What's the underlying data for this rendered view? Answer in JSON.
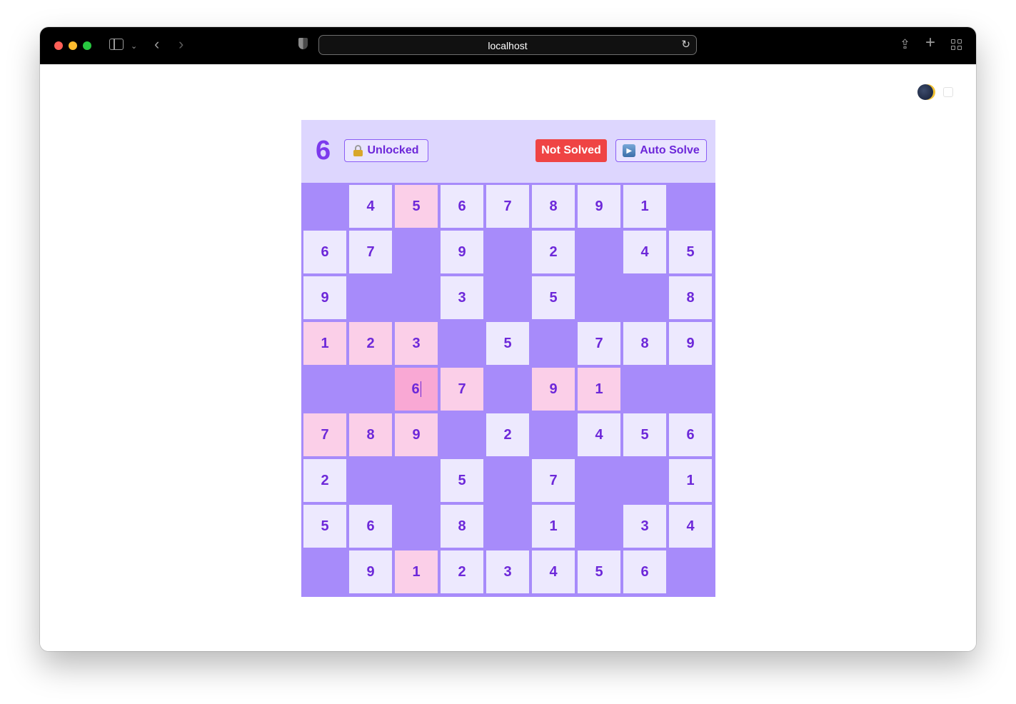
{
  "browser": {
    "url": "localhost"
  },
  "game": {
    "selected_digit": "6",
    "lock_label": "Unlocked",
    "status_label": "Not Solved",
    "auto_solve_label": "Auto Solve",
    "colors": {
      "accent": "#7c3aed",
      "panel": "#ddd6fe",
      "cell": "#ede9fe",
      "blocked": "#a78bfa",
      "highlight": "#fbcfe8",
      "active": "#f9a8d4",
      "status": "#ef4444"
    },
    "active_cell": {
      "row": 4,
      "col": 2
    },
    "board": [
      [
        {
          "v": "",
          "t": "blocked"
        },
        {
          "v": "4",
          "t": "normal"
        },
        {
          "v": "5",
          "t": "pink"
        },
        {
          "v": "6",
          "t": "normal"
        },
        {
          "v": "7",
          "t": "normal"
        },
        {
          "v": "8",
          "t": "normal"
        },
        {
          "v": "9",
          "t": "normal"
        },
        {
          "v": "1",
          "t": "normal"
        },
        {
          "v": "",
          "t": "blocked"
        }
      ],
      [
        {
          "v": "6",
          "t": "normal"
        },
        {
          "v": "7",
          "t": "normal"
        },
        {
          "v": "",
          "t": "blocked"
        },
        {
          "v": "9",
          "t": "normal"
        },
        {
          "v": "",
          "t": "blocked"
        },
        {
          "v": "2",
          "t": "normal"
        },
        {
          "v": "",
          "t": "blocked"
        },
        {
          "v": "4",
          "t": "normal"
        },
        {
          "v": "5",
          "t": "normal"
        }
      ],
      [
        {
          "v": "9",
          "t": "normal"
        },
        {
          "v": "",
          "t": "blocked"
        },
        {
          "v": "",
          "t": "blocked"
        },
        {
          "v": "3",
          "t": "normal"
        },
        {
          "v": "",
          "t": "blocked"
        },
        {
          "v": "5",
          "t": "normal"
        },
        {
          "v": "",
          "t": "blocked"
        },
        {
          "v": "",
          "t": "blocked"
        },
        {
          "v": "8",
          "t": "normal"
        }
      ],
      [
        {
          "v": "1",
          "t": "pink"
        },
        {
          "v": "2",
          "t": "pink"
        },
        {
          "v": "3",
          "t": "pink"
        },
        {
          "v": "",
          "t": "blocked"
        },
        {
          "v": "5",
          "t": "normal"
        },
        {
          "v": "",
          "t": "blocked"
        },
        {
          "v": "7",
          "t": "normal"
        },
        {
          "v": "8",
          "t": "normal"
        },
        {
          "v": "9",
          "t": "normal"
        }
      ],
      [
        {
          "v": "",
          "t": "blocked"
        },
        {
          "v": "",
          "t": "blocked"
        },
        {
          "v": "6",
          "t": "active"
        },
        {
          "v": "7",
          "t": "pink"
        },
        {
          "v": "",
          "t": "blocked"
        },
        {
          "v": "9",
          "t": "pink"
        },
        {
          "v": "1",
          "t": "pink"
        },
        {
          "v": "",
          "t": "blocked"
        },
        {
          "v": "",
          "t": "blocked"
        }
      ],
      [
        {
          "v": "7",
          "t": "pink"
        },
        {
          "v": "8",
          "t": "pink"
        },
        {
          "v": "9",
          "t": "pink"
        },
        {
          "v": "",
          "t": "blocked"
        },
        {
          "v": "2",
          "t": "normal"
        },
        {
          "v": "",
          "t": "blocked"
        },
        {
          "v": "4",
          "t": "normal"
        },
        {
          "v": "5",
          "t": "normal"
        },
        {
          "v": "6",
          "t": "normal"
        }
      ],
      [
        {
          "v": "2",
          "t": "normal"
        },
        {
          "v": "",
          "t": "blocked"
        },
        {
          "v": "",
          "t": "blocked"
        },
        {
          "v": "5",
          "t": "normal"
        },
        {
          "v": "",
          "t": "blocked"
        },
        {
          "v": "7",
          "t": "normal"
        },
        {
          "v": "",
          "t": "blocked"
        },
        {
          "v": "",
          "t": "blocked"
        },
        {
          "v": "1",
          "t": "normal"
        }
      ],
      [
        {
          "v": "5",
          "t": "normal"
        },
        {
          "v": "6",
          "t": "normal"
        },
        {
          "v": "",
          "t": "blocked"
        },
        {
          "v": "8",
          "t": "normal"
        },
        {
          "v": "",
          "t": "blocked"
        },
        {
          "v": "1",
          "t": "normal"
        },
        {
          "v": "",
          "t": "blocked"
        },
        {
          "v": "3",
          "t": "normal"
        },
        {
          "v": "4",
          "t": "normal"
        }
      ],
      [
        {
          "v": "",
          "t": "blocked"
        },
        {
          "v": "9",
          "t": "normal"
        },
        {
          "v": "1",
          "t": "pink"
        },
        {
          "v": "2",
          "t": "normal"
        },
        {
          "v": "3",
          "t": "normal"
        },
        {
          "v": "4",
          "t": "normal"
        },
        {
          "v": "5",
          "t": "normal"
        },
        {
          "v": "6",
          "t": "normal"
        },
        {
          "v": "",
          "t": "blocked"
        }
      ]
    ]
  }
}
